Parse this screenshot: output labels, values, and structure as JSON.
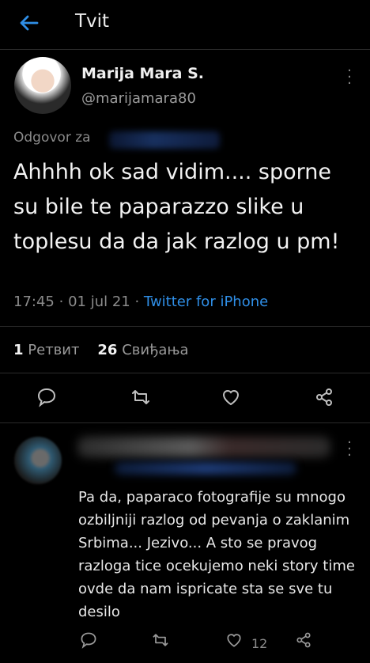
{
  "header": {
    "title": "Tvit",
    "back_icon": "arrow-left-icon",
    "accent": "#2f8ee6"
  },
  "tweet": {
    "author_name": "Marija Mara S.",
    "author_handle": "@marijamara80",
    "reply_prefix": "Odgovor za",
    "text": "Ahhhh ok sad vidim.... sporne su bile te paparazzo slike u toplesu da da jak razlog u pm!",
    "time": "17:45",
    "date": "01 jul 21",
    "source": "Twitter for iPhone",
    "retweets_count": "1",
    "retweets_label": "Ретвит",
    "likes_count": "26",
    "likes_label": "Свиђања"
  },
  "reply": {
    "text": "Pa da, paparaco fotografije su mnogo ozbiljniji razlog od pevanja o zaklanim Srbima... Jezivo... A sto se pravog razloga tice ocekujemo neki story time ovde da nam ispricate sta se sve tu desilo",
    "likes_count": "12"
  }
}
